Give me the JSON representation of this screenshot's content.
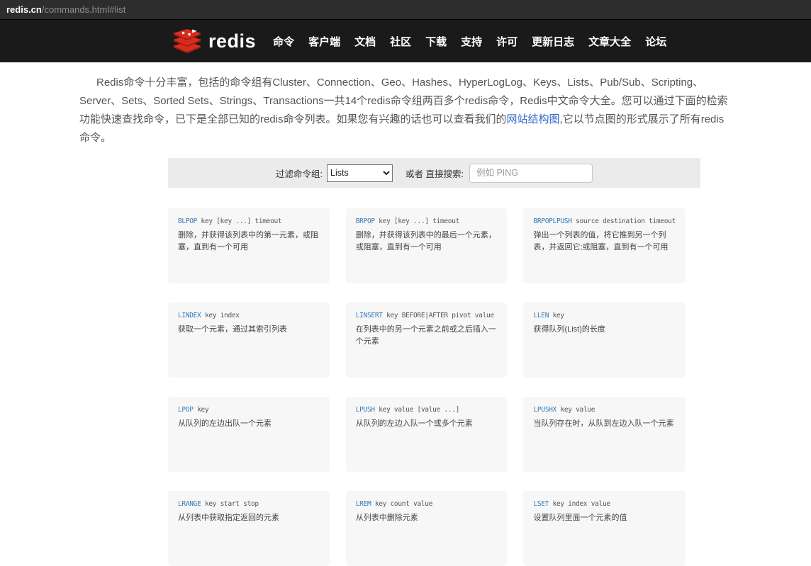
{
  "browser": {
    "url_host": "redis.cn",
    "url_path": "/commands.html#list"
  },
  "navbar": {
    "brand": "redis",
    "items": [
      "命令",
      "客户端",
      "文档",
      "社区",
      "下载",
      "支持",
      "许可",
      "更新日志",
      "文章大全",
      "论坛"
    ]
  },
  "intro": {
    "text_before_link": "Redis命令十分丰富，包括的命令组有Cluster、Connection、Geo、Hashes、HyperLogLog、Keys、Lists、Pub/Sub、Scripting、Server、Sets、Sorted Sets、Strings、Transactions一共14个redis命令组两百多个redis命令，Redis中文命令大全。您可以通过下面的检索功能快速查找命令，已下是全部已知的redis命令列表。如果您有兴趣的话也可以查看我们的",
    "link_text": "网站结构图",
    "text_after_link": ",它以节点图的形式展示了所有redis命令。"
  },
  "filter": {
    "group_label": "过滤命令组:",
    "group_value": "Lists",
    "search_label": "或者 直接搜索:",
    "search_placeholder": "例如 PING"
  },
  "cards": [
    {
      "name": "BLPOP",
      "args": "key [key ...] timeout",
      "desc": "删除，并获得该列表中的第一元素，或阻塞，直到有一个可用"
    },
    {
      "name": "BRPOP",
      "args": "key [key ...] timeout",
      "desc": "删除，并获得该列表中的最后一个元素，或阻塞，直到有一个可用"
    },
    {
      "name": "BRPOPLPUSH",
      "args": "source destination timeout",
      "desc": "弹出一个列表的值，将它推到另一个列表，并返回它;或阻塞，直到有一个可用"
    },
    {
      "name": "LINDEX",
      "args": "key index",
      "desc": "获取一个元素，通过其索引列表"
    },
    {
      "name": "LINSERT",
      "args": "key BEFORE|AFTER pivot value",
      "desc": "在列表中的另一个元素之前或之后插入一个元素"
    },
    {
      "name": "LLEN",
      "args": "key",
      "desc": "获得队列(List)的长度"
    },
    {
      "name": "LPOP",
      "args": "key",
      "desc": "从队列的左边出队一个元素"
    },
    {
      "name": "LPUSH",
      "args": "key value [value ...]",
      "desc": "从队列的左边入队一个或多个元素"
    },
    {
      "name": "LPUSHX",
      "args": "key value",
      "desc": "当队列存在时，从队到左边入队一个元素"
    },
    {
      "name": "LRANGE",
      "args": "key start stop",
      "desc": "从列表中获取指定返回的元素"
    },
    {
      "name": "LREM",
      "args": "key count value",
      "desc": "从列表中删除元素"
    },
    {
      "name": "LSET",
      "args": "key index value",
      "desc": "设置队列里面一个元素的值"
    }
  ],
  "colors": {
    "brand_red": "#d82c20",
    "brand_red_dark": "#a41e11",
    "command_link_blue": "#337ab7",
    "intro_link_blue": "#3366cc",
    "navbar_bg": "#1a1a1a",
    "address_bar_bg": "#2d2d2d",
    "filter_bar_bg": "#ebebeb",
    "card_bg": "#f7f7f7"
  }
}
